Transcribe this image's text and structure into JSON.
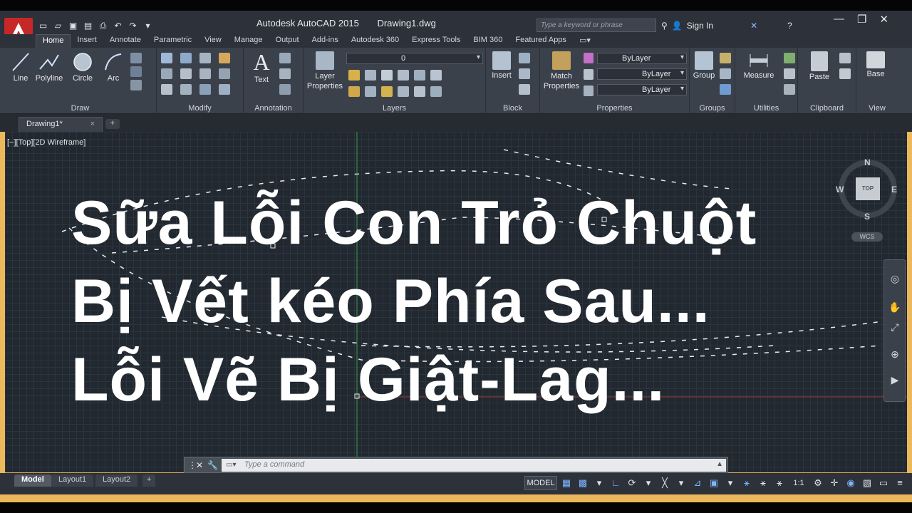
{
  "colors": {
    "accent": "#ecb85c",
    "app_red": "#c62828",
    "canvas_bg": "#212830",
    "ribbon_bg": "#3b414b"
  },
  "titlebar": {
    "app_name": "Autodesk AutoCAD 2015",
    "document": "Drawing1.dwg",
    "search_placeholder": "Type a keyword or phrase",
    "sign_in": "Sign In",
    "qat_icons": [
      "new-icon",
      "open-icon",
      "save-icon",
      "save-as-icon",
      "plot-icon",
      "undo-icon",
      "redo-icon"
    ]
  },
  "ribbon_tabs": [
    "Home",
    "Insert",
    "Annotate",
    "Parametric",
    "View",
    "Manage",
    "Output",
    "Add-ins",
    "Autodesk 360",
    "Express Tools",
    "BIM 360",
    "Featured Apps"
  ],
  "panels": {
    "draw": {
      "title": "Draw",
      "line": "Line",
      "polyline": "Polyline",
      "circle": "Circle",
      "arc": "Arc"
    },
    "modify": {
      "title": "Modify"
    },
    "annotation": {
      "title": "Annotation",
      "text": "Text"
    },
    "layers": {
      "title": "Layers",
      "layer_properties_1": "Layer",
      "layer_properties_2": "Properties",
      "current_layer": "0"
    },
    "block": {
      "title": "Block",
      "insert": "Insert"
    },
    "properties": {
      "title": "Properties",
      "match_1": "Match",
      "match_2": "Properties",
      "color": "ByLayer",
      "linetype": "ByLayer",
      "lineweight": "ByLayer"
    },
    "groups": {
      "title": "Groups",
      "group": "Group"
    },
    "utilities": {
      "title": "Utilities",
      "measure": "Measure"
    },
    "clipboard": {
      "title": "Clipboard",
      "paste": "Paste"
    },
    "view": {
      "title": "View",
      "base": "Base"
    }
  },
  "doc_tab": {
    "name": "Drawing1*",
    "close": "×",
    "new": "+"
  },
  "canvas": {
    "view_label": "[−][Top][2D Wireframe]",
    "overlay_lines": [
      "Sữa Lỗi Con Trỏ Chuột",
      "Bị Vết kéo Phía Sau...",
      "Lỗi Vẽ Bị Giật-Lag..."
    ]
  },
  "viewcube": {
    "n": "N",
    "s": "S",
    "e": "E",
    "w": "W",
    "face": "TOP",
    "ucs": "WCS"
  },
  "command_line": {
    "placeholder": "Type a command"
  },
  "status": {
    "layout_tabs": [
      "Model",
      "Layout1",
      "Layout2"
    ],
    "add_layout": "+",
    "model_toggle": "MODEL",
    "scale": "1:1"
  }
}
